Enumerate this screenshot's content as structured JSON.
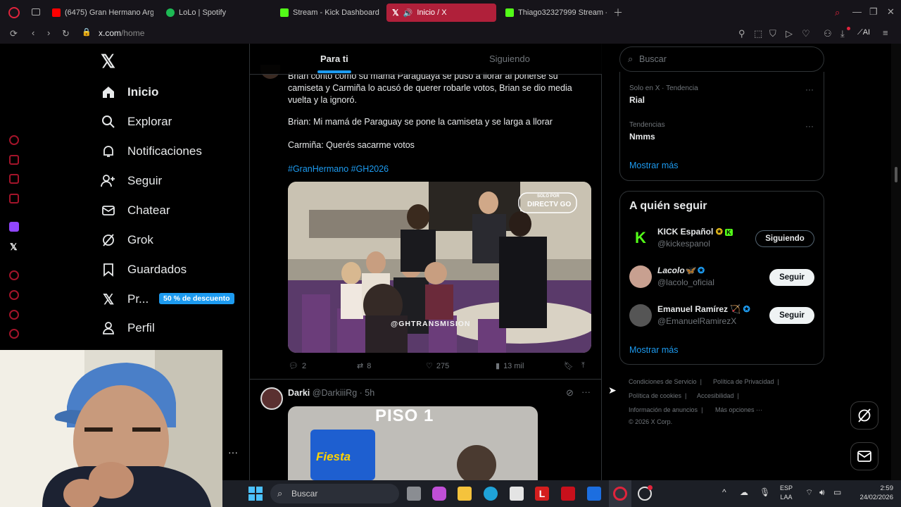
{
  "browser": {
    "tabs": [
      {
        "label": "(6475) Gran Hermano Arge",
        "icon": "youtube-icon",
        "color": "#ff0000"
      },
      {
        "label": "LoLo | Spotify",
        "icon": "spotify-icon",
        "color": "#1db954"
      },
      {
        "label": "Stream - Kick Dashboard",
        "icon": "kick-icon",
        "color": "#53fc18"
      },
      {
        "label": "Inicio / X",
        "icon": "x-icon",
        "color": "#ffffff"
      },
      {
        "label": "Thiago32327999 Stream -",
        "icon": "kick-icon",
        "color": "#53fc18"
      }
    ],
    "url_domain": "x.com",
    "url_path": "/home",
    "ai_label": "AI"
  },
  "nav": {
    "items": [
      {
        "label": "Inicio",
        "icon": "home-icon"
      },
      {
        "label": "Explorar",
        "icon": "search-icon"
      },
      {
        "label": "Notificaciones",
        "icon": "bell-icon"
      },
      {
        "label": "Seguir",
        "icon": "add-user-icon"
      },
      {
        "label": "Chatear",
        "icon": "mail-icon"
      },
      {
        "label": "Grok",
        "icon": "grok-icon"
      },
      {
        "label": "Guardados",
        "icon": "bookmark-icon"
      },
      {
        "label": "Pr...",
        "icon": "x-icon"
      },
      {
        "label": "Perfil",
        "icon": "person-icon"
      }
    ],
    "premium_badge": "50 % de descuento"
  },
  "feed": {
    "tab_for_you": "Para ti",
    "tab_following": "Siguiendo",
    "tweet1": {
      "text_top": "Brian contó como su mamá Paraguaya se puso a llorar al ponerse su camiseta y Carmiña lo acusó de querer robarle votos, Brian se dio media vuelta y la ignoró.",
      "quote1": "Brian: Mi mamá de Paraguay se pone la camiseta y se larga a llorar",
      "quote2": "Carmiña: Querés sacarme votos",
      "hashtags": "#GranHermano #GH2026",
      "media_badge_top": "SOLO POR",
      "media_badge": "DIRECTV GO",
      "media_watermark": "@GHTRANSMISION",
      "replies": "2",
      "retweets": "8",
      "likes": "275",
      "views": "13 mil"
    },
    "tweet2": {
      "name": "Darki",
      "handle": "@DarkiiiRg",
      "time": "· 5h",
      "media_text": "PISO 1",
      "media_product": "Fiesta"
    }
  },
  "right": {
    "search_placeholder": "Buscar",
    "trends": [
      {
        "meta": "Solo en X · Tendencia",
        "name": "Rial"
      },
      {
        "meta": "Tendencias",
        "name": "Nmms"
      }
    ],
    "show_more": "Mostrar más",
    "who_to_follow": {
      "title": "A quién seguir",
      "users": [
        {
          "name": "KICK Español",
          "handle": "@kickespanol",
          "button": "Siguiendo",
          "avatar_color": "#53fc18"
        },
        {
          "name": "Lacolo🦋",
          "handle": "@lacolo_oficial",
          "button": "Seguir",
          "avatar_color": "#c8a090"
        },
        {
          "name": "Emanuel Ramírez 🏹",
          "handle": "@EmanuelRamirezX",
          "button": "Seguir",
          "avatar_color": "#555"
        }
      ],
      "show_more": "Mostrar más"
    },
    "footer": {
      "links": [
        "Condiciones de Servicio",
        "Política de Privacidad",
        "Política de cookies",
        "Accesibilidad",
        "Información de anuncios",
        "Más opciones ···"
      ],
      "copyright": "© 2026 X Corp."
    }
  },
  "taskbar": {
    "search_placeholder": "Buscar",
    "lang": "ESP",
    "lang_sub": "LAA",
    "time": "2:59",
    "date": "24/02/2026"
  },
  "colors": {
    "accent": "#1d9bf0",
    "opera_red": "#b0203a",
    "kick_green": "#53fc18"
  }
}
